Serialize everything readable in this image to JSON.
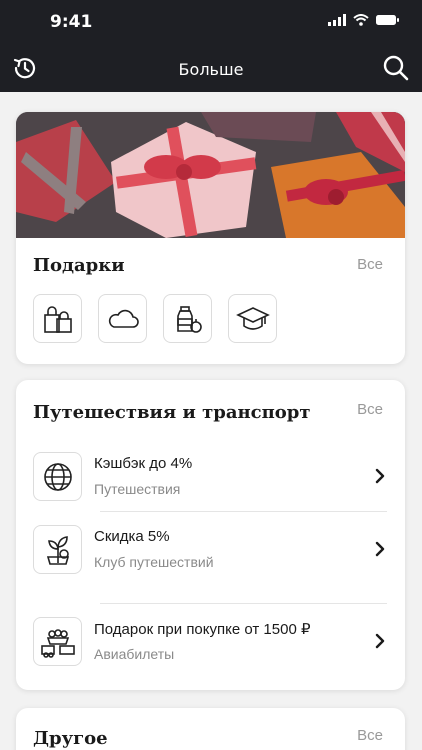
{
  "status_bar": {
    "time": "9:41"
  },
  "nav": {
    "title": "Больше",
    "left_icon": "history-icon",
    "right_icon": "search-icon"
  },
  "gifts": {
    "title": "Подарки",
    "all_label": "Все",
    "icons": [
      "shopping-bags-icon",
      "cloud-icon",
      "groceries-icon",
      "graduation-cap-icon"
    ]
  },
  "travel": {
    "title": "Путешествия и транспорт",
    "all_label": "Все",
    "items": [
      {
        "title": "Кэшбэк до 4%",
        "subtitle": "Путешествия",
        "icon": "globe-icon"
      },
      {
        "title": "Скидка 5%",
        "subtitle": "Клуб путешествий",
        "icon": "plant-icon"
      },
      {
        "title": "Подарок при покупке от 1500 ₽",
        "subtitle": "Авиабилеты",
        "icon": "gift-basket-icon"
      }
    ]
  },
  "other": {
    "title": "Другое",
    "all_label": "Все"
  }
}
